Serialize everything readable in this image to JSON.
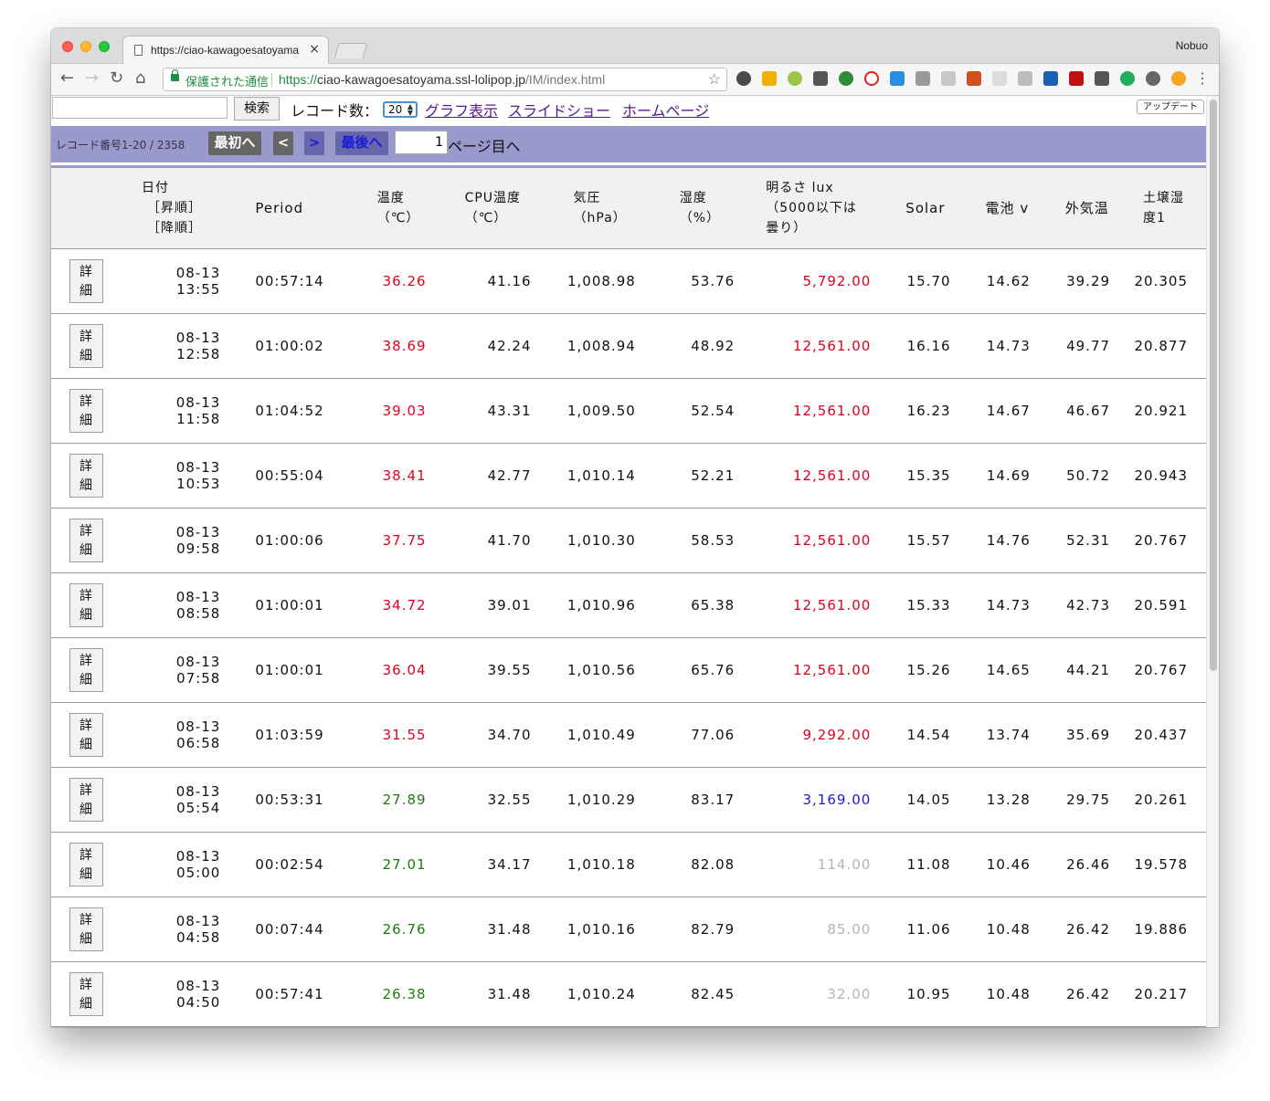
{
  "browser": {
    "tab_title": "https://ciao-kawagoesatoyama",
    "tab_close": "×",
    "profile_name": "Nobuo",
    "secure_label": "保護された通信",
    "url_scheme": "https://",
    "url_host": "ciao-kawagoesatoyama.ssl-lolipop.jp",
    "url_path": "/IM/index.html"
  },
  "search": {
    "button_label": "検索",
    "record_count_label": "レコード数：",
    "record_count_value": "20",
    "links": [
      "グラフ表示",
      "スライドショー",
      "ホームページ"
    ],
    "update_label": "アップデート"
  },
  "pager": {
    "record_range": "レコード番号1-20 / 2358",
    "first_label": "最初へ",
    "prev_label": "<",
    "next_label": ">",
    "last_label": "最後へ",
    "page_value": "1",
    "page_suffix": "ページ目へ"
  },
  "table": {
    "headers": {
      "date_1": "日付",
      "date_2": "［昇順］",
      "date_3": "［降順］",
      "period": "Period",
      "temp_1": "温度",
      "temp_2": "（℃）",
      "cpu_1": "CPU温度",
      "cpu_2": "（℃）",
      "pressure_1": "気圧",
      "pressure_2": "（hPa）",
      "humidity_1": "湿度",
      "humidity_2": "（%）",
      "lux_1": "明るさ lux",
      "lux_2": "（5000以下は",
      "lux_3": "曇り）",
      "solar": "Solar",
      "battery": "電池 v",
      "outside": "外気温",
      "soil_1": "土壌湿",
      "soil_2": "度1"
    },
    "detail_label_1": "詳",
    "detail_label_2": "細",
    "rows": [
      {
        "date": "08-13",
        "time": "13:55",
        "period": "00:57:14",
        "temp": "36.26",
        "temp_color": "#e0001f",
        "cpu": "41.16",
        "pressure": "1,008.98",
        "humidity": "53.76",
        "lux": "5,792.00",
        "lux_color": "#e0001f",
        "solar": "15.70",
        "battery": "14.62",
        "outside": "39.29",
        "soil": "20.305"
      },
      {
        "date": "08-13",
        "time": "12:58",
        "period": "01:00:02",
        "temp": "38.69",
        "temp_color": "#e0001f",
        "cpu": "42.24",
        "pressure": "1,008.94",
        "humidity": "48.92",
        "lux": "12,561.00",
        "lux_color": "#e0001f",
        "solar": "16.16",
        "battery": "14.73",
        "outside": "49.77",
        "soil": "20.877"
      },
      {
        "date": "08-13",
        "time": "11:58",
        "period": "01:04:52",
        "temp": "39.03",
        "temp_color": "#e0001f",
        "cpu": "43.31",
        "pressure": "1,009.50",
        "humidity": "52.54",
        "lux": "12,561.00",
        "lux_color": "#e0001f",
        "solar": "16.23",
        "battery": "14.67",
        "outside": "46.67",
        "soil": "20.921"
      },
      {
        "date": "08-13",
        "time": "10:53",
        "period": "00:55:04",
        "temp": "38.41",
        "temp_color": "#e0001f",
        "cpu": "42.77",
        "pressure": "1,010.14",
        "humidity": "52.21",
        "lux": "12,561.00",
        "lux_color": "#e0001f",
        "solar": "15.35",
        "battery": "14.69",
        "outside": "50.72",
        "soil": "20.943"
      },
      {
        "date": "08-13",
        "time": "09:58",
        "period": "01:00:06",
        "temp": "37.75",
        "temp_color": "#e0001f",
        "cpu": "41.70",
        "pressure": "1,010.30",
        "humidity": "58.53",
        "lux": "12,561.00",
        "lux_color": "#e0001f",
        "solar": "15.57",
        "battery": "14.76",
        "outside": "52.31",
        "soil": "20.767"
      },
      {
        "date": "08-13",
        "time": "08:58",
        "period": "01:00:01",
        "temp": "34.72",
        "temp_color": "#e0001f",
        "cpu": "39.01",
        "pressure": "1,010.96",
        "humidity": "65.38",
        "lux": "12,561.00",
        "lux_color": "#e0001f",
        "solar": "15.33",
        "battery": "14.73",
        "outside": "42.73",
        "soil": "20.591"
      },
      {
        "date": "08-13",
        "time": "07:58",
        "period": "01:00:01",
        "temp": "36.04",
        "temp_color": "#e0001f",
        "cpu": "39.55",
        "pressure": "1,010.56",
        "humidity": "65.76",
        "lux": "12,561.00",
        "lux_color": "#e0001f",
        "solar": "15.26",
        "battery": "14.65",
        "outside": "44.21",
        "soil": "20.767"
      },
      {
        "date": "08-13",
        "time": "06:58",
        "period": "01:03:59",
        "temp": "31.55",
        "temp_color": "#e0001f",
        "cpu": "34.70",
        "pressure": "1,010.49",
        "humidity": "77.06",
        "lux": "9,292.00",
        "lux_color": "#e0001f",
        "solar": "14.54",
        "battery": "13.74",
        "outside": "35.69",
        "soil": "20.437"
      },
      {
        "date": "08-13",
        "time": "05:54",
        "period": "00:53:31",
        "temp": "27.89",
        "temp_color": "#207a10",
        "cpu": "32.55",
        "pressure": "1,010.29",
        "humidity": "83.17",
        "lux": "3,169.00",
        "lux_color": "#1a1adb",
        "solar": "14.05",
        "battery": "13.28",
        "outside": "29.75",
        "soil": "20.261"
      },
      {
        "date": "08-13",
        "time": "05:00",
        "period": "00:02:54",
        "temp": "27.01",
        "temp_color": "#207a10",
        "cpu": "34.17",
        "pressure": "1,010.18",
        "humidity": "82.08",
        "lux": "114.00",
        "lux_color": "#b4b4b4",
        "solar": "11.08",
        "battery": "10.46",
        "outside": "26.46",
        "soil": "19.578"
      },
      {
        "date": "08-13",
        "time": "04:58",
        "period": "00:07:44",
        "temp": "26.76",
        "temp_color": "#207a10",
        "cpu": "31.48",
        "pressure": "1,010.16",
        "humidity": "82.79",
        "lux": "85.00",
        "lux_color": "#b4b4b4",
        "solar": "11.06",
        "battery": "10.48",
        "outside": "26.42",
        "soil": "19.886"
      },
      {
        "date": "08-13",
        "time": "04:50",
        "period": "00:57:41",
        "temp": "26.38",
        "temp_color": "#207a10",
        "cpu": "31.48",
        "pressure": "1,010.24",
        "humidity": "82.45",
        "lux": "32.00",
        "lux_color": "#b4b4b4",
        "solar": "10.95",
        "battery": "10.48",
        "outside": "26.42",
        "soil": "20.217"
      }
    ]
  }
}
